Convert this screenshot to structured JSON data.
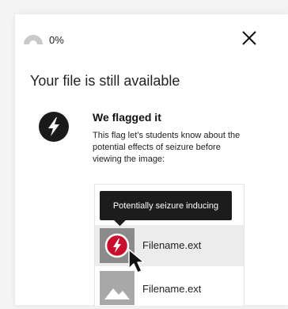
{
  "progress": {
    "text": "0%",
    "value": 0
  },
  "dialog": {
    "title": "Your file is still available",
    "close_label": "Close"
  },
  "flag": {
    "heading": "We flagged it",
    "description": "This flag let’s students know about the potential effects of seizure before viewing the image:",
    "icon": "lightning-bolt-icon"
  },
  "tooltip": {
    "text": "Potentially seizure inducing"
  },
  "files": [
    {
      "name": "Filename.ext",
      "thumbnail": "seizure-flag-thumbnail",
      "highlighted": true
    },
    {
      "name": "Filename.ext",
      "thumbnail": "image-placeholder-thumbnail",
      "highlighted": false
    }
  ],
  "colors": {
    "flag_red": "#c8102e",
    "badge_black": "#1a1a1a",
    "tooltip_bg": "#1c1c1c",
    "row_highlight": "#ececec",
    "background": "#f3f3f3"
  }
}
